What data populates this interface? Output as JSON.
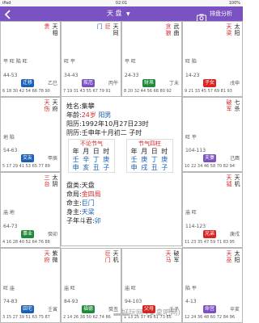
{
  "status_bar": {
    "device": "iPad",
    "time": "02:01",
    "battery": "100%"
  },
  "nav": {
    "title": "天 盘",
    "sort_label": "排盘分析",
    "back_icon": "back-arrow-icon",
    "camera_icon": "camera-icon",
    "accent": "#7b52c1"
  },
  "palaces": [
    {
      "id": "p1",
      "stars": [
        "天相",
        "贵"
      ],
      "extra": "平 旺 陷 旺",
      "dizhi": "乙巳",
      "tag": "迁移",
      "tag_color": "#1a5fb4",
      "ages": "6 18 30 42 54 66 78 90",
      "age_range": "44-53"
    },
    {
      "id": "p2",
      "stars": [
        "天同",
        "巨",
        "门"
      ],
      "extra": "旺 平",
      "dizhi": "丙午",
      "tag": "疾厄",
      "tag_color": "#7b52c1",
      "ages": "7 19 31 43 55 67 79 91",
      "age_range": "34-43"
    },
    {
      "id": "p3",
      "stars": [
        "武曲",
        "贪狼"
      ],
      "extra": "平 旺",
      "dizhi": "丁未",
      "tag": "财帛",
      "tag_color": "#1f8a3a",
      "ages": "8 20 32 44 56 68 80 92",
      "age_range": "24-33"
    },
    {
      "id": "p4",
      "stars": [
        "太阳",
        "天梁"
      ],
      "extra": "旺 陷",
      "dizhi": "戊申",
      "tag": "子女",
      "tag_color": "#d22",
      "ages": "9 21 33 45 57 69 81 93",
      "age_range": "14-23"
    },
    {
      "id": "p5",
      "stars": [
        "天府",
        "天伤"
      ],
      "extra": "地 陷",
      "dizhi": "甲辰",
      "tag": "交友",
      "tag_color": "#1a5fb4",
      "ages": "5 17 29 41 53 65 77 89",
      "age_range": "54-63"
    },
    {
      "id": "p6",
      "stars": [
        "七杀",
        "破军"
      ],
      "extra": "旺 平",
      "dizhi": "己酉",
      "tag": "夫妻",
      "tag_color": "#7b52c1",
      "ages": "10 22 34 46 58 70 82 94",
      "age_range": "104-113"
    },
    {
      "id": "p7",
      "stars": [
        "太阴",
        "三台"
      ],
      "extra": "庙 地",
      "dizhi": "癸卯",
      "tag": "事业",
      "tag_color": "#1f8a3a",
      "ages": "4 16 28 40 52 64 76 88",
      "age_range": "64-73"
    },
    {
      "id": "p8",
      "stars": [
        "天机",
        "天钺"
      ],
      "extra": "庙 旺",
      "dizhi": "庚戌",
      "tag": "兄弟",
      "tag_color": "#d22",
      "ages": "11 23 35 47 59 71 83 95",
      "age_range": "114-123"
    },
    {
      "id": "p9",
      "stars": [
        "紫微",
        "天府"
      ],
      "extra": "旺 庙",
      "dizhi": "壬寅",
      "tag": "田宅",
      "tag_color": "#1a5fb4",
      "ages": "3 15 27 39 51 63 75 87",
      "age_range": "74-83"
    },
    {
      "id": "p10",
      "stars": [
        "天机",
        "巨门"
      ],
      "extra": "庙 旺",
      "dizhi": "癸丑",
      "tag": "福德",
      "tag_color": "#1f8a3a",
      "ages": "2 14 26 38 50 62 74 86",
      "age_range": "84-93"
    },
    {
      "id": "p11",
      "stars": [
        "破军",
        "天马"
      ],
      "extra": "庙 旺",
      "dizhi": "壬子",
      "tag": "父母",
      "tag_color": "#d22",
      "ages": "1 13 25 37 49 61 73 85",
      "age_range": "94-103"
    },
    {
      "id": "p12",
      "stars": [
        "太阳",
        "天巫"
      ],
      "extra": "陷 平",
      "dizhi": "辛亥",
      "tag": "命宫",
      "tag_color": "#7b52c1",
      "ages": "12 24 36 48 60 72 84 96",
      "age_range": "4-13"
    }
  ],
  "center": {
    "name": "姓名:集攀",
    "age_label": "年龄:",
    "age_value": "24岁",
    "gender": "阳男",
    "solar": "阳历:1992年10月27日23时",
    "lunar": "阴历:壬申年十月初二 子时",
    "pillar_a_title": "不论节气",
    "pillar_b_title": "节气四柱",
    "pillar_row1": "年 月 日 时",
    "pillar_a_row2": "壬 辛 丁 庚",
    "pillar_a_row3": "申 亥 丑 子",
    "pillar_b_row2": "壬 庚 丁 庚",
    "pillar_b_row3": "申 戌 丑 子",
    "pan_label": "盘类:天盘",
    "ju_label": "命局:",
    "ju_value": "金四局",
    "ming_label": "命主:",
    "ming_value": "巨门",
    "shen_label": "身主:",
    "shen_value": "天梁",
    "zidou_label": "子年斗君:",
    "zidou_value": "卯"
  },
  "watermark": "好玩网 (艾拿吧网)"
}
